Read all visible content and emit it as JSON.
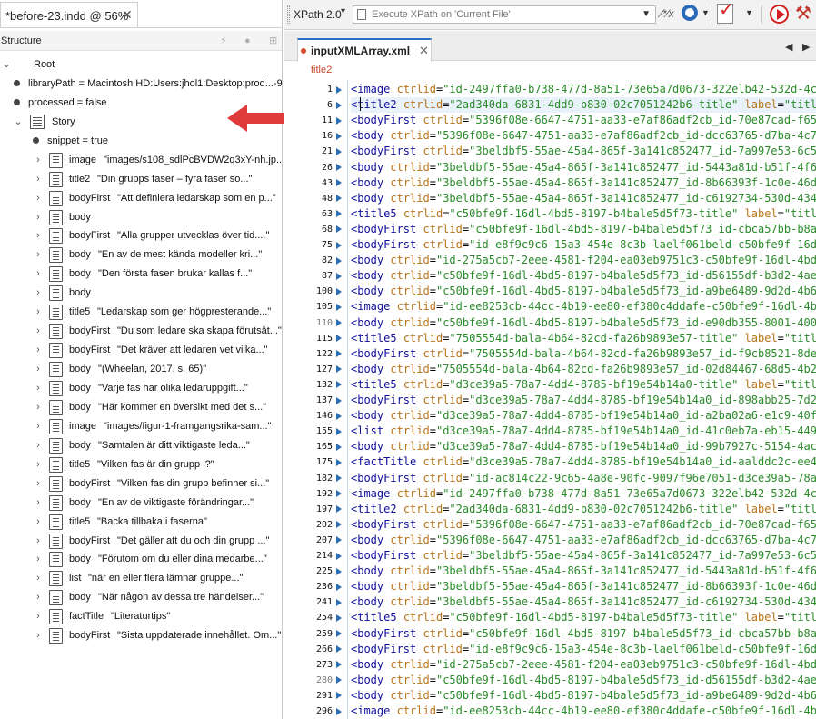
{
  "left_panel": {
    "doc_tab": {
      "title": "*before-23.indd @ 56%",
      "close": "✕"
    },
    "structure_title": "Structure",
    "tree": [
      {
        "type": "root",
        "label": "Root"
      },
      {
        "type": "attr",
        "label": "libraryPath = Macintosh HD:Users:jhol1:Desktop:prod...-98f3-"
      },
      {
        "type": "attr",
        "label": "processed = false"
      },
      {
        "type": "story",
        "label": "Story"
      },
      {
        "type": "attr",
        "label": "snippet = true"
      },
      {
        "type": "elem",
        "tag": "image",
        "value": "\"images/s108_sdlPcBVDW2q3xY-nh.jp...\""
      },
      {
        "type": "elem",
        "tag": "title2",
        "value": "\"Din grupps faser – fyra faser so...\""
      },
      {
        "type": "elem",
        "tag": "bodyFirst",
        "value": "\"Att definiera ledarskap som en p...\""
      },
      {
        "type": "elem",
        "tag": "body",
        "value": ""
      },
      {
        "type": "elem",
        "tag": "bodyFirst",
        "value": "\"Alla grupper utvecklas över tid....\""
      },
      {
        "type": "elem",
        "tag": "body",
        "value": "\"En av de mest kända modeller kri...\""
      },
      {
        "type": "elem",
        "tag": "body",
        "value": "\"Den första fasen brukar kallas f...\""
      },
      {
        "type": "elem",
        "tag": "body",
        "value": ""
      },
      {
        "type": "elem",
        "tag": "title5",
        "value": "\"Ledarskap som ger högpresterande...\""
      },
      {
        "type": "elem",
        "tag": "bodyFirst",
        "value": "\"Du som ledare ska skapa förutsät...\""
      },
      {
        "type": "elem",
        "tag": "bodyFirst",
        "value": "\"Det kräver att ledaren vet vilka...\""
      },
      {
        "type": "elem",
        "tag": "body",
        "value": "\"(Wheelan, 2017, s. 65)\""
      },
      {
        "type": "elem",
        "tag": "body",
        "value": "\"Varje fas har olika ledaruppgift...\""
      },
      {
        "type": "elem",
        "tag": "body",
        "value": "\"Här kommer en översikt med det s...\""
      },
      {
        "type": "elem",
        "tag": "image",
        "value": "\"images/figur-1-framgangsrika-sam...\""
      },
      {
        "type": "elem",
        "tag": "body",
        "value": "\"Samtalen är ditt viktigaste leda...\""
      },
      {
        "type": "elem",
        "tag": "title5",
        "value": "\"Vilken fas är din grupp i?\""
      },
      {
        "type": "elem",
        "tag": "bodyFirst",
        "value": "\"Vilken fas din grupp befinner si...\""
      },
      {
        "type": "elem",
        "tag": "body",
        "value": "\"En av de viktigaste förändringar...\""
      },
      {
        "type": "elem",
        "tag": "title5",
        "value": "\"Backa tillbaka i faserna\""
      },
      {
        "type": "elem",
        "tag": "bodyFirst",
        "value": "\"Det gäller att du och din grupp ...\""
      },
      {
        "type": "elem",
        "tag": "body",
        "value": "\"Förutom om du eller dina medarbe...\""
      },
      {
        "type": "elem",
        "tag": "list",
        "value": "\"när en eller flera lämnar gruppe...\""
      },
      {
        "type": "elem",
        "tag": "body",
        "value": "\"När någon av dessa tre händelser...\""
      },
      {
        "type": "elem",
        "tag": "factTitle",
        "value": "\"Literaturtips\""
      },
      {
        "type": "elem",
        "tag": "bodyFirst",
        "value": "\"Sista uppdaterade innehållet. Om...\""
      }
    ]
  },
  "toolbar": {
    "xpath_version": "XPath 2.0",
    "xpath_placeholder": "Execute XPath on 'Current File'"
  },
  "editor": {
    "tab_title": "inputXMLArray.xml",
    "tab_close": "✕",
    "breadcrumb": "title2",
    "lines": [
      {
        "n": "1",
        "tag": "image",
        "attr": "ctrlid",
        "val": "\"id-2497ffa0-b738-477d-8a51-73e65a7d0673-322elb42-532d-4cl"
      },
      {
        "n": "6",
        "tag": "title2",
        "attr": "ctrlid",
        "val": "\"2ad340da-6831-4dd9-b830-02c7051242b6-title\"",
        "attr2": "label",
        "val2": "\"title"
      },
      {
        "n": "11",
        "tag": "bodyFirst",
        "attr": "ctrlid",
        "val": "\"5396f08e-6647-4751-aa33-e7af86adf2cb_id-70e87cad-f65b"
      },
      {
        "n": "16",
        "tag": "body",
        "attr": "ctrlid",
        "val": "\"5396f08e-6647-4751-aa33-e7af86adf2cb_id-dcc63765-d7ba-4c7c"
      },
      {
        "n": "21",
        "tag": "bodyFirst",
        "attr": "ctrlid",
        "val": "\"3beldbf5-55ae-45a4-865f-3a141c852477_id-7a997e53-6c5b"
      },
      {
        "n": "26",
        "tag": "body",
        "attr": "ctrlid",
        "val": "\"3beldbf5-55ae-45a4-865f-3a141c852477_id-5443a81d-b51f-4f6c"
      },
      {
        "n": "43",
        "tag": "body",
        "attr": "ctrlid",
        "val": "\"3beldbf5-55ae-45a4-865f-3a141c852477_id-8b66393f-1c0e-46dc"
      },
      {
        "n": "48",
        "tag": "body",
        "attr": "ctrlid",
        "val": "\"3beldbf5-55ae-45a4-865f-3a141c852477_id-c6192734-530d-434a"
      },
      {
        "n": "63",
        "tag": "title5",
        "attr": "ctrlid",
        "val": "\"c50bfe9f-16dl-4bd5-8197-b4bale5d5f73-title\"",
        "attr2": "label",
        "val2": "\"title"
      },
      {
        "n": "68",
        "tag": "bodyFirst",
        "attr": "ctrlid",
        "val": "\"c50bfe9f-16dl-4bd5-8197-b4bale5d5f73_id-cbca57bb-b8a8"
      },
      {
        "n": "75",
        "tag": "bodyFirst",
        "attr": "ctrlid",
        "val": "\"id-e8f9c9c6-15a3-454e-8c3b-laelf061beld-c50bfe9f-16dl"
      },
      {
        "n": "82",
        "tag": "body",
        "attr": "ctrlid",
        "val": "\"id-275a5cb7-2eee-4581-f204-ea03eb9751c3-c50bfe9f-16dl-4bd5"
      },
      {
        "n": "87",
        "tag": "body",
        "attr": "ctrlid",
        "val": "\"c50bfe9f-16dl-4bd5-8197-b4bale5d5f73_id-d56155df-b3d2-4ae7"
      },
      {
        "n": "100",
        "tag": "body",
        "attr": "ctrlid",
        "val": "\"c50bfe9f-16dl-4bd5-8197-b4bale5d5f73_id-a9be6489-9d2d-4b63"
      },
      {
        "n": "105",
        "tag": "image",
        "attr": "ctrlid",
        "val": "\"id-ee8253cb-44cc-4b19-ee80-ef380c4ddafe-c50bfe9f-16dl-4bc"
      },
      {
        "n": "110",
        "tag": "body",
        "attr": "ctrlid",
        "val": "\"c50bfe9f-16dl-4bd5-8197-b4bale5d5f73_id-e90db355-8001-4007",
        "dim": true
      },
      {
        "n": "115",
        "tag": "title5",
        "attr": "ctrlid",
        "val": "\"7505554d-bala-4b64-82cd-fa26b9893e57-title\"",
        "attr2": "label",
        "val2": "\"title"
      },
      {
        "n": "122",
        "tag": "bodyFirst",
        "attr": "ctrlid",
        "val": "\"7505554d-bala-4b64-82cd-fa26b9893e57_id-f9cb8521-8de4"
      },
      {
        "n": "127",
        "tag": "body",
        "attr": "ctrlid",
        "val": "\"7505554d-bala-4b64-82cd-fa26b9893e57_id-02d84467-68d5-4b2f"
      },
      {
        "n": "132",
        "tag": "title5",
        "attr": "ctrlid",
        "val": "\"d3ce39a5-78a7-4dd4-8785-bf19e54b14a0-title\"",
        "attr2": "label",
        "val2": "\"title"
      },
      {
        "n": "137",
        "tag": "bodyFirst",
        "attr": "ctrlid",
        "val": "\"d3ce39a5-78a7-4dd4-8785-bf19e54b14a0_id-898abb25-7d2b"
      },
      {
        "n": "146",
        "tag": "body",
        "attr": "ctrlid",
        "val": "\"d3ce39a5-78a7-4dd4-8785-bf19e54b14a0_id-a2ba02a6-e1c9-40f2"
      },
      {
        "n": "155",
        "tag": "list",
        "attr": "ctrlid",
        "val": "\"d3ce39a5-78a7-4dd4-8785-bf19e54b14a0_id-41c0eb7a-eb15-449c"
      },
      {
        "n": "165",
        "tag": "body",
        "attr": "ctrlid",
        "val": "\"d3ce39a5-78a7-4dd4-8785-bf19e54b14a0_id-99b7927c-5154-4ac8"
      },
      {
        "n": "175",
        "tag": "factTitle",
        "attr": "ctrlid",
        "val": "\"d3ce39a5-78a7-4dd4-8785-bf19e54b14a0_id-aalddc2c-ee4f"
      },
      {
        "n": "182",
        "tag": "bodyFirst",
        "attr": "ctrlid",
        "val": "\"id-ac814c22-9c65-4a8e-90fc-9097f96e7051-d3ce39a5-78a7-4dd4"
      },
      {
        "n": "192",
        "tag": "image",
        "attr": "ctrlid",
        "val": "\"id-2497ffa0-b738-477d-8a51-73e65a7d0673-322elb42-532d-4cl"
      },
      {
        "n": "197",
        "tag": "title2",
        "attr": "ctrlid",
        "val": "\"2ad340da-6831-4dd9-b830-02c7051242b6-title\"",
        "attr2": "label",
        "val2": "\"title"
      },
      {
        "n": "202",
        "tag": "bodyFirst",
        "attr": "ctrlid",
        "val": "\"5396f08e-6647-4751-aa33-e7af86adf2cb_id-70e87cad-f65b"
      },
      {
        "n": "207",
        "tag": "body",
        "attr": "ctrlid",
        "val": "\"5396f08e-6647-4751-aa33-e7af86adf2cb_id-dcc63765-d7ba-4c7c"
      },
      {
        "n": "214",
        "tag": "bodyFirst",
        "attr": "ctrlid",
        "val": "\"3beldbf5-55ae-45a4-865f-3a141c852477_id-7a997e53-6c5b"
      },
      {
        "n": "225",
        "tag": "body",
        "attr": "ctrlid",
        "val": "\"3beldbf5-55ae-45a4-865f-3a141c852477_id-5443a81d-b51f-4f6c"
      },
      {
        "n": "236",
        "tag": "body",
        "attr": "ctrlid",
        "val": "\"3beldbf5-55ae-45a4-865f-3a141c852477_id-8b66393f-1c0e-46dc"
      },
      {
        "n": "241",
        "tag": "body",
        "attr": "ctrlid",
        "val": "\"3beldbf5-55ae-45a4-865f-3a141c852477_id-c6192734-530d-434a"
      },
      {
        "n": "254",
        "tag": "title5",
        "attr": "ctrlid",
        "val": "\"c50bfe9f-16dl-4bd5-8197-b4bale5d5f73-title\"",
        "attr2": "label",
        "val2": "\"title"
      },
      {
        "n": "259",
        "tag": "bodyFirst",
        "attr": "ctrlid",
        "val": "\"c50bfe9f-16dl-4bd5-8197-b4bale5d5f73_id-cbca57bb-b8a8"
      },
      {
        "n": "266",
        "tag": "bodyFirst",
        "attr": "ctrlid",
        "val": "\"id-e8f9c9c6-15a3-454e-8c3b-laelf061beld-c50bfe9f-16dl"
      },
      {
        "n": "273",
        "tag": "body",
        "attr": "ctrlid",
        "val": "\"id-275a5cb7-2eee-4581-f204-ea03eb9751c3-c50bfe9f-16dl-4bd5"
      },
      {
        "n": "280",
        "tag": "body",
        "attr": "ctrlid",
        "val": "\"c50bfe9f-16dl-4bd5-8197-b4bale5d5f73_id-d56155df-b3d2-4ae7",
        "dim": true
      },
      {
        "n": "291",
        "tag": "body",
        "attr": "ctrlid",
        "val": "\"c50bfe9f-16dl-4bd5-8197-b4bale5d5f73_id-a9be6489-9d2d-4b63"
      },
      {
        "n": "296",
        "tag": "image",
        "attr": "ctrlid",
        "val": "\"id-ee8253cb-44cc-4b19-ee80-ef380c4ddafe-c50bfe9f-16dl-4bc"
      }
    ]
  },
  "colors": {
    "tag": "#0f0f9a",
    "attribute": "#b8741a",
    "attribute_value": "#2b8b2b",
    "breadcrumb": "#c9452a",
    "arrow": "#e03b3b"
  },
  "icons": {
    "structure_header": [
      "lightning-icon",
      "circle-icon",
      "add-icon"
    ],
    "toolbar": [
      "document-icon",
      "execute-xpath-icon",
      "gear-icon",
      "validate-icon",
      "transform-icon",
      "configure-icon"
    ]
  }
}
